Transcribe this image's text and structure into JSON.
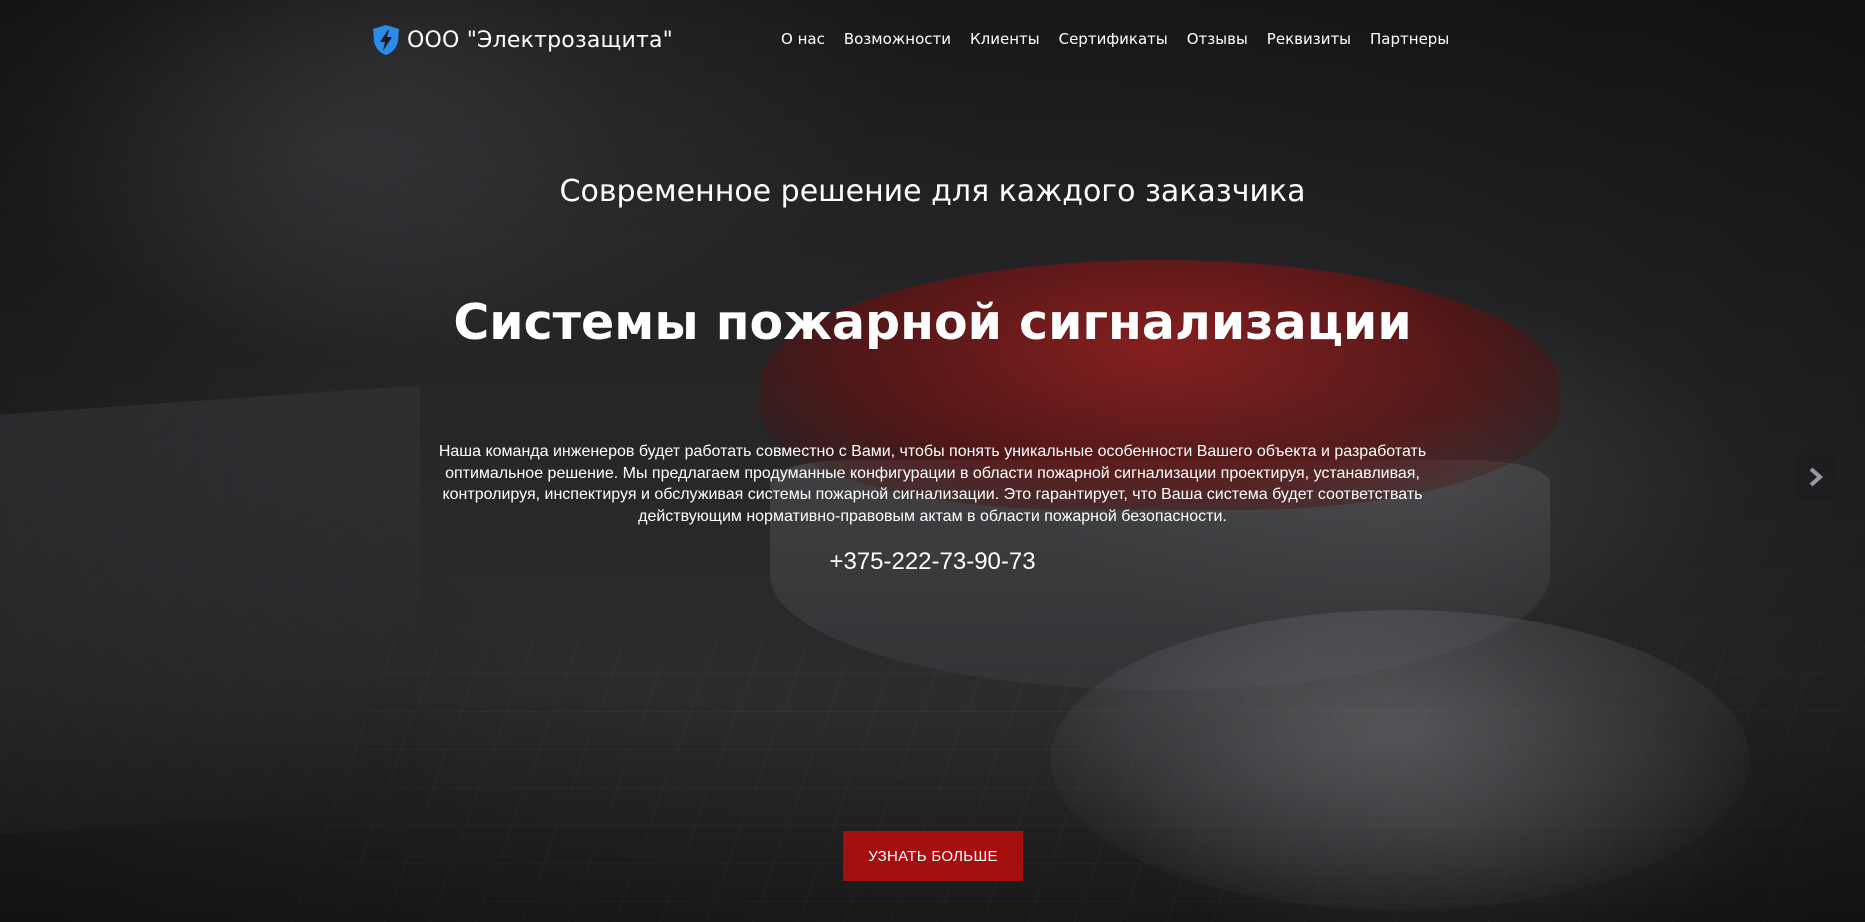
{
  "brand": {
    "name": "ООО \"Электрозащита\"",
    "icon": "lightning-shield-icon",
    "icon_color": "#2a8be8"
  },
  "nav": {
    "items": [
      {
        "label": "О нас"
      },
      {
        "label": "Возможности"
      },
      {
        "label": "Клиенты"
      },
      {
        "label": "Сертификаты"
      },
      {
        "label": "Отзывы"
      },
      {
        "label": "Реквизиты"
      },
      {
        "label": "Партнеры"
      }
    ]
  },
  "hero": {
    "subtitle": "Современное решение для каждого заказчика",
    "title": "Системы пожарной сигнализации",
    "description": "Наша команда инженеров будет работать совместно с Вами, чтобы понять уникальные особенности Вашего объекта и разработать оптимальное решение. Мы предлагаем продуманные конфигурации в области пожарной сигнализации проектируя, устанавливая, контролируя, инспектируя и обслуживая системы пожарной сигнализации. Это гарантирует, что Ваша система будет соответствать действующим нормативно-правовым актам в области пожарной безопасности.",
    "phone": "+375-222-73-90-73",
    "cta_label": "УЗНАТЬ БОЛЬШЕ",
    "cta_color": "#a50e0e",
    "next_icon": "chevron-right-icon"
  }
}
